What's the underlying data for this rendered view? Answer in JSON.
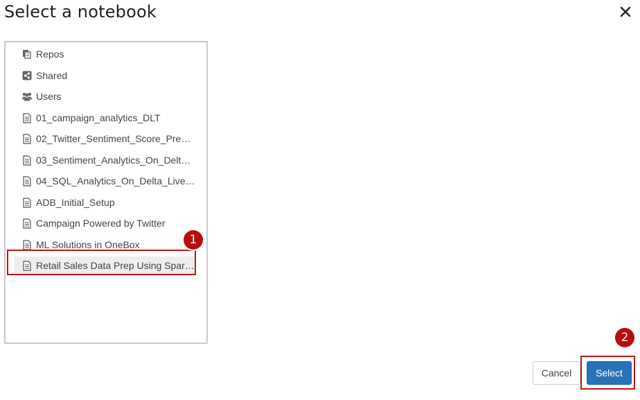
{
  "dialog": {
    "title": "Select a notebook",
    "close_icon": "close-icon"
  },
  "tree": {
    "items": [
      {
        "label": "Repos",
        "icon": "repos-icon"
      },
      {
        "label": "Shared",
        "icon": "share-icon"
      },
      {
        "label": "Users",
        "icon": "users-icon"
      },
      {
        "label": "01_campaign_analytics_DLT",
        "icon": "notebook-file-icon"
      },
      {
        "label": "02_Twitter_Sentiment_Score_Pred_...",
        "icon": "notebook-file-icon"
      },
      {
        "label": "03_Sentiment_Analytics_On_Delta_...",
        "icon": "notebook-file-icon"
      },
      {
        "label": "04_SQL_Analytics_On_Delta_Live_T...",
        "icon": "notebook-file-icon"
      },
      {
        "label": "ADB_Initial_Setup",
        "icon": "notebook-file-icon"
      },
      {
        "label": "Campaign Powered by Twitter",
        "icon": "notebook-file-icon"
      },
      {
        "label": "ML Solutions in OneBox",
        "icon": "notebook-file-icon"
      },
      {
        "label": "Retail Sales Data Prep Using Spark ...",
        "icon": "notebook-file-icon",
        "selected": true
      }
    ]
  },
  "buttons": {
    "cancel_label": "Cancel",
    "select_label": "Select"
  },
  "annotations": {
    "marker_1": "1",
    "marker_2": "2",
    "marker_color": "#b80d0d"
  },
  "colors": {
    "primary_button": "#2a72b8",
    "selected_row": "#eeeeee",
    "annotation_border": "#c01616"
  }
}
